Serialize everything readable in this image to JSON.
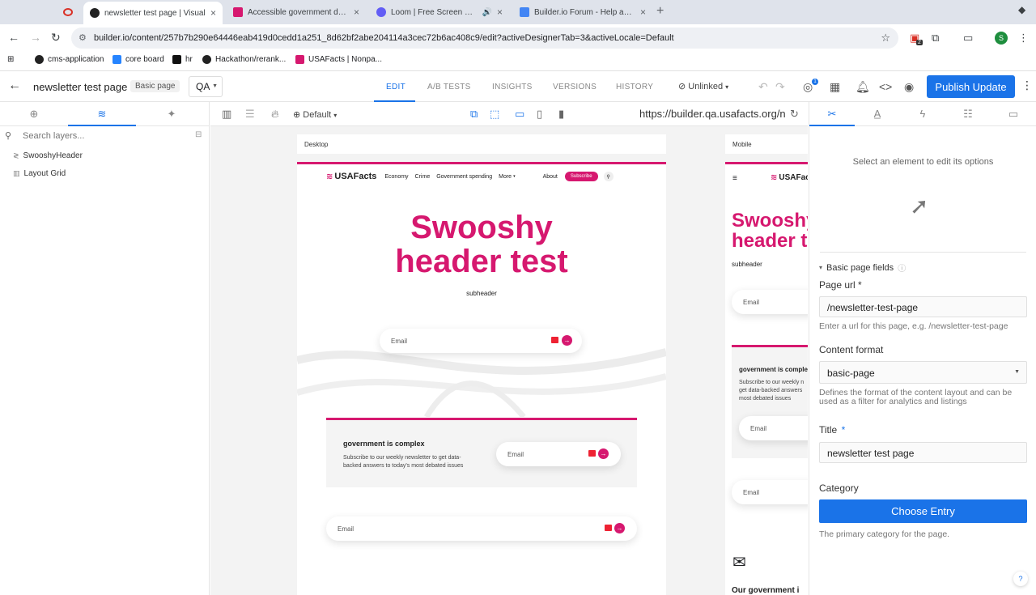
{
  "browser": {
    "tabs": [
      {
        "title": "",
        "active": false,
        "color": "#d93025"
      },
      {
        "title": "newsletter test page | Visual ",
        "active": true,
        "color": "#222222"
      },
      {
        "title": "Accessible government data",
        "active": false,
        "color": "#d6186f"
      },
      {
        "title": "Loom | Free Screen & Vid",
        "active": false,
        "color": "#625df5"
      },
      {
        "title": "Builder.io Forum - Help and t",
        "active": false,
        "color": "#4285f4"
      }
    ],
    "new_tab": "+",
    "url": "builder.io/content/257b7b290e64446eab419d0cedd1a251_8d62bf2abe204114a3cec72b6ac408c9/edit?activeDesignerTab=3&activeLocale=Default",
    "profile_initial": "S",
    "ext_badge": "2",
    "bookmarks": [
      {
        "label": "cms-application",
        "icon": "github-icon"
      },
      {
        "label": "core board",
        "icon": "jira-icon"
      },
      {
        "label": "hr",
        "icon": "tiktok-icon"
      },
      {
        "label": "Hackathon/rerank...",
        "icon": "github-icon"
      },
      {
        "label": "USAFacts | Nonpa...",
        "icon": "usafacts-icon"
      }
    ]
  },
  "app": {
    "page_name": "newsletter test page",
    "page_type": "Basic page",
    "environment": "QA",
    "main_tabs": [
      "EDIT",
      "A/B TESTS",
      "INSIGHTS",
      "VERSIONS",
      "HISTORY"
    ],
    "active_tab": "EDIT",
    "link_status": "Unlinked",
    "notification_count": "1",
    "publish_label": "Publish Update"
  },
  "left_panel": {
    "search_placeholder": "Search layers...",
    "layers": [
      "SwooshyHeader",
      "Layout Grid"
    ]
  },
  "canvas": {
    "locale": "Default",
    "preview_url": "https://builder.qa.usafacts.org/n",
    "desktop_label": "Desktop",
    "mobile_label": "Mobile",
    "site": {
      "logo": "USAFacts",
      "nav": [
        "Economy",
        "Crime",
        "Government spending",
        "More"
      ],
      "about": "About",
      "subscribe": "Subscribe",
      "hero_line1": "Swooshy",
      "hero_line2": "header test",
      "mobile_hero_line1": "Swooshy",
      "mobile_hero_line2": "header t",
      "subheader": "subheader",
      "email_label": "Email",
      "card_title": "government is complex",
      "card_text": "Subscribe to our weekly newsletter to get data-backed answers to today's most debated issues",
      "mobile_card_title": "government is complex",
      "mobile_card_text": "Subscribe to our weekly n get data-backed answers most debated issues",
      "mobile_footer_text": "Our government i"
    }
  },
  "right_panel": {
    "hint": "Select an element to edit its options",
    "section_title": "Basic page fields",
    "page_url_label": "Page url",
    "page_url_required": "*",
    "page_url_value": "/newsletter-test-page",
    "page_url_help": "Enter a url for this page, e.g. /newsletter-test-page",
    "content_format_label": "Content format",
    "content_format_value": "basic-page",
    "content_format_help": "Defines the format of the content layout and can be used as a filter for analytics and listings",
    "title_label": "Title",
    "title_required": "*",
    "title_value": "newsletter test page",
    "category_label": "Category",
    "choose_entry_label": "Choose Entry",
    "category_help": "The primary category for the page.",
    "help_label": "?"
  },
  "colors": {
    "accent": "#1a73e8",
    "brand_pink": "#d6186f"
  }
}
